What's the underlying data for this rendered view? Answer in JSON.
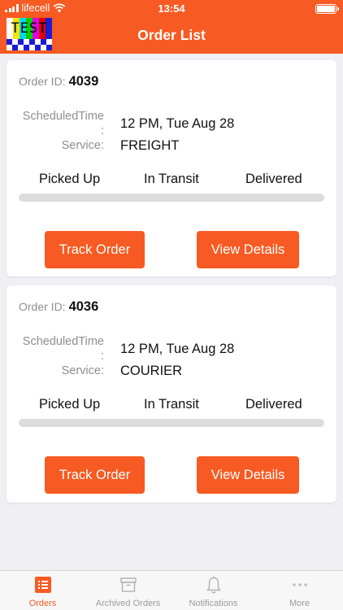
{
  "status_bar": {
    "carrier": "lifecell",
    "time": "13:54"
  },
  "header": {
    "title": "Order List",
    "logo_text": "TEST"
  },
  "labels": {
    "order_id": "Order ID:",
    "scheduled_time_line1": "ScheduledTime",
    "scheduled_time_line2": ":",
    "service": "Service:"
  },
  "steps": [
    "Picked Up",
    "In Transit",
    "Delivered"
  ],
  "orders": [
    {
      "order_id": "4039",
      "scheduled_time": "12 PM, Tue Aug 28",
      "service": "FREIGHT",
      "progress_percent": 0,
      "track_label": "Track Order",
      "details_label": "View Details"
    },
    {
      "order_id": "4036",
      "scheduled_time": "12 PM, Tue Aug 28",
      "service": "COURIER",
      "progress_percent": 0,
      "track_label": "Track Order",
      "details_label": "View Details"
    }
  ],
  "tabbar": {
    "items": [
      {
        "label": "Orders",
        "icon": "list-icon",
        "active": true
      },
      {
        "label": "Archived Orders",
        "icon": "archive-box-icon",
        "active": false
      },
      {
        "label": "Notifications",
        "icon": "bell-icon",
        "active": false
      },
      {
        "label": "More",
        "icon": "more-dots-icon",
        "active": false
      }
    ]
  },
  "colors": {
    "accent": "#f75a22",
    "inactive": "#9b9b9b",
    "background": "#efeff4"
  }
}
